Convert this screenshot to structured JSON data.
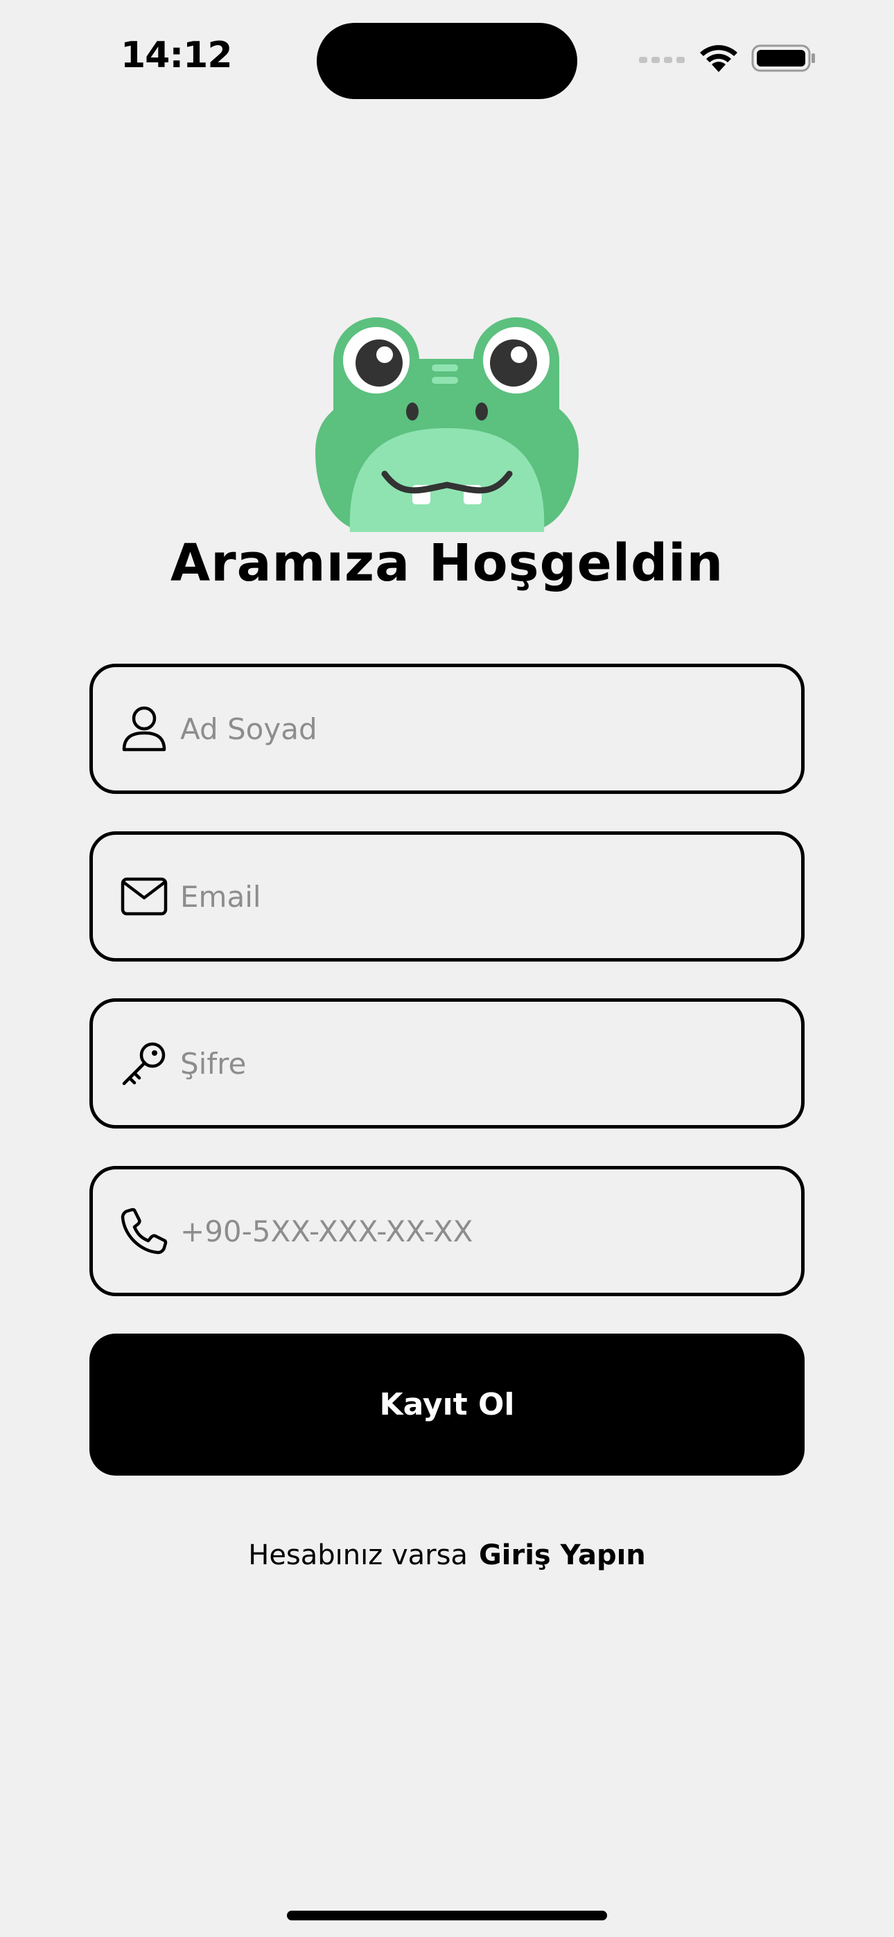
{
  "status_bar": {
    "time": "14:12",
    "icons": [
      "cellular-signal-icon",
      "wifi-icon",
      "battery-icon"
    ]
  },
  "header": {
    "mascot": "frog-mascot-logo",
    "title": "Aramıza Hoşgeldin"
  },
  "form": {
    "name_placeholder": "Ad Soyad",
    "email_placeholder": "Email",
    "password_placeholder": "Şifre",
    "phone_placeholder": "+90-5XX-XXX-XX-XX",
    "icons": [
      "user-icon",
      "mail-icon",
      "key-icon",
      "phone-icon"
    ],
    "submit_label": "Kayıt Ol"
  },
  "footer": {
    "prompt": "Hesabınız varsa",
    "link": "Giriş Yapın"
  },
  "colors": {
    "background": "#f0f0f0",
    "primary": "#000000",
    "placeholder": "#8d8d8d",
    "mascot_green": "#5cc07f",
    "mascot_light_green": "#8fe3b1"
  }
}
